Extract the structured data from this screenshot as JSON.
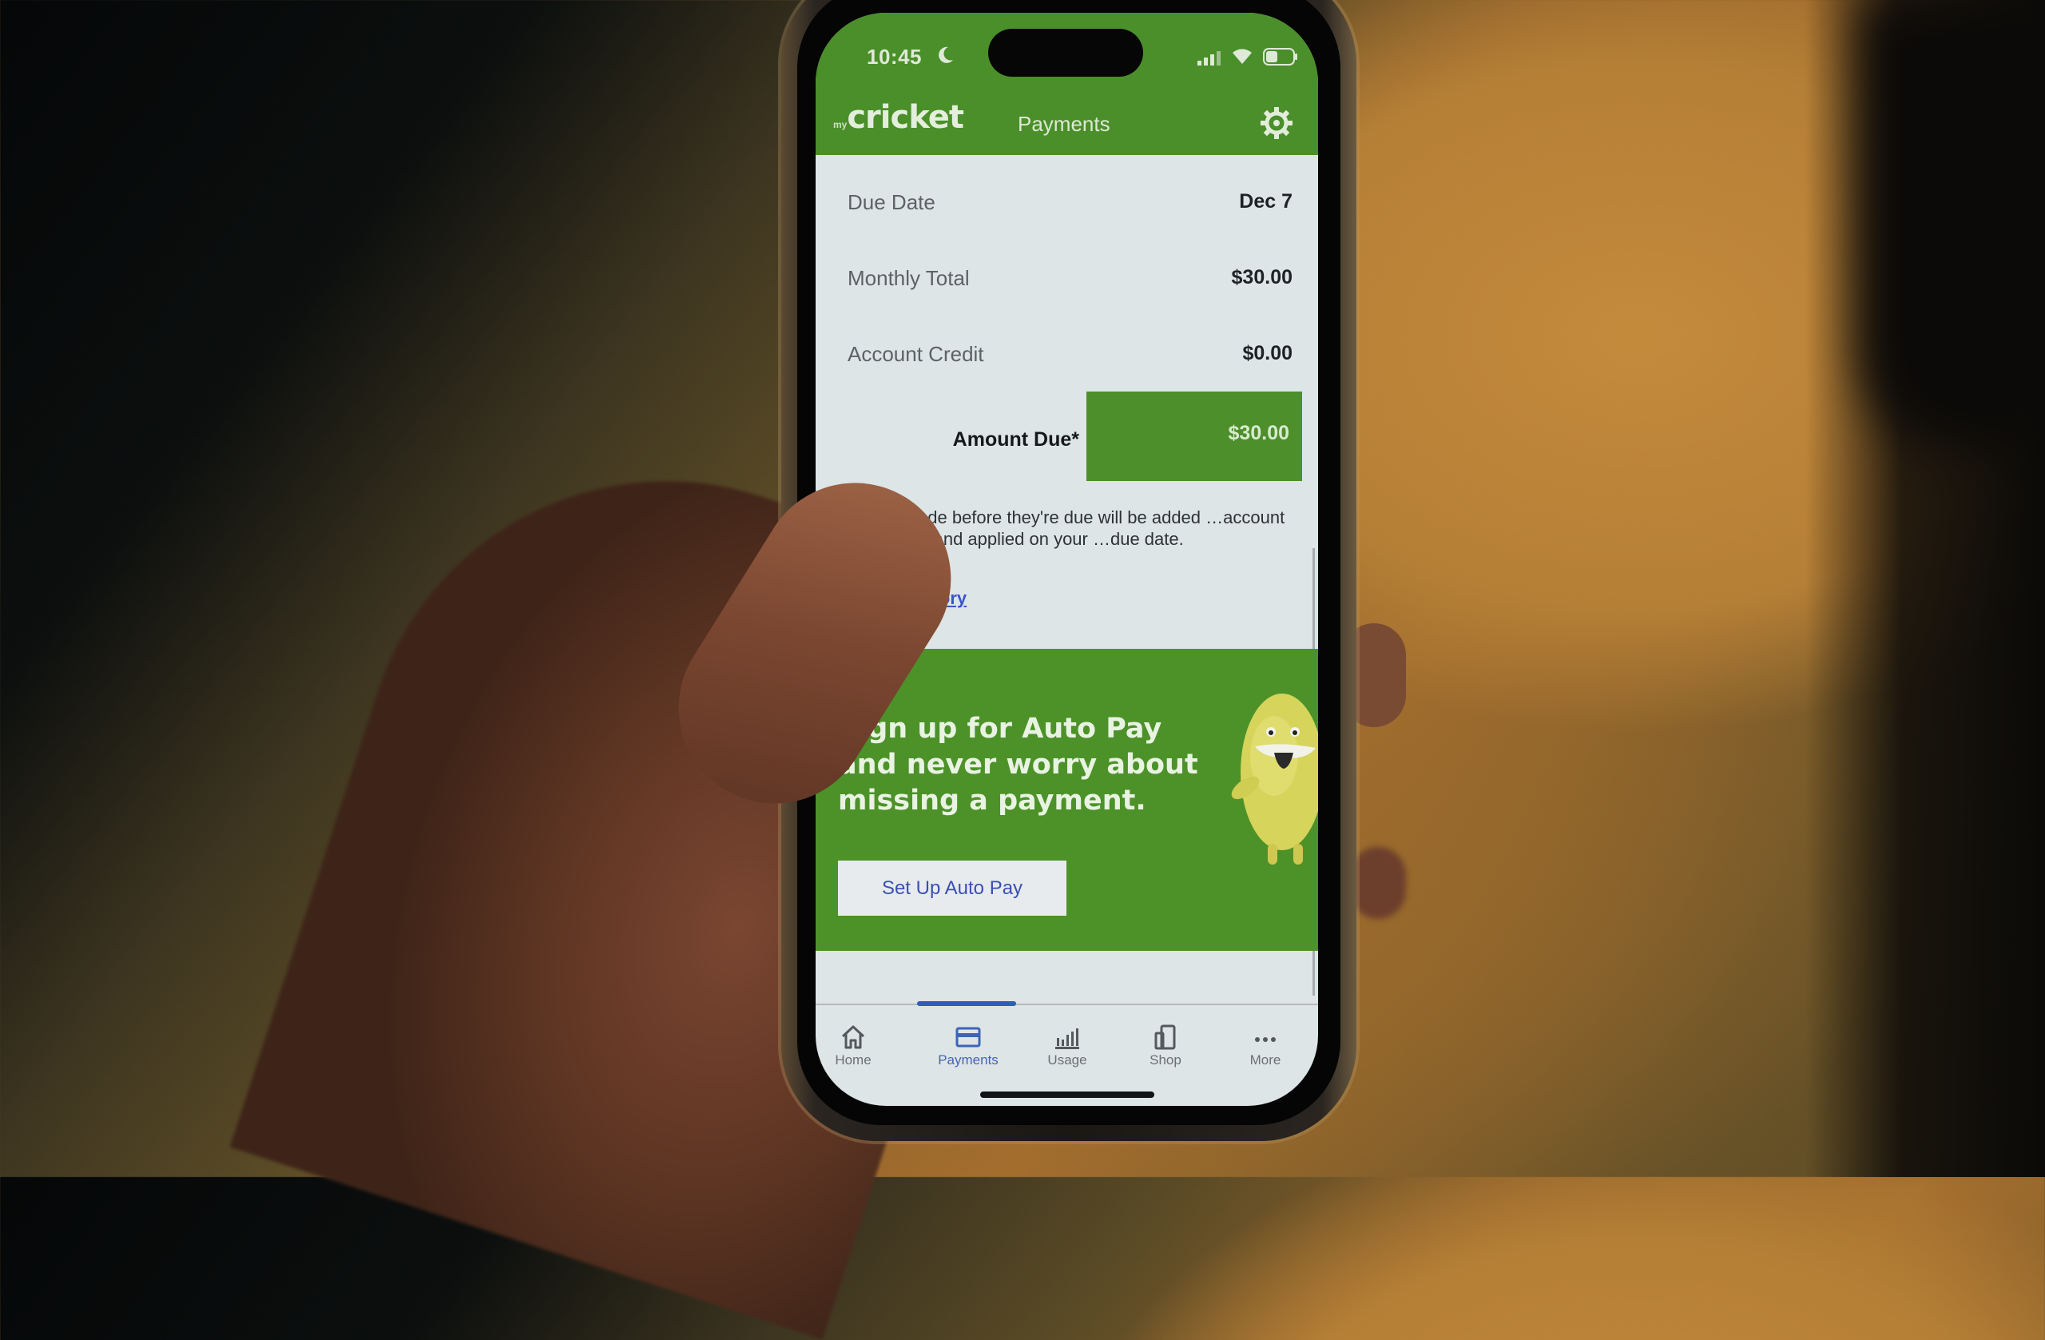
{
  "status_bar": {
    "time": "10:45",
    "focus_icon": "moon-icon",
    "signal_icon": "cellular-signal-icon",
    "wifi_icon": "wifi-icon",
    "battery_icon": "battery-icon"
  },
  "header": {
    "logo_prefix": "my",
    "logo_text": "cricket",
    "title": "Payments",
    "settings_icon": "gear-icon"
  },
  "summary": {
    "rows": [
      {
        "label": "Due Date",
        "value": "Dec 7"
      },
      {
        "label": "Monthly Total",
        "value": "$30.00"
      },
      {
        "label": "Account Credit",
        "value": "$0.00"
      }
    ],
    "amount_due_label": "Amount Due*",
    "amount_due_value": "$30.00",
    "footnote": "…ents made before they're due will be added …account as a credit and applied on your …due date.",
    "billing_history_link": "Billing History"
  },
  "promo": {
    "title": "Sign up for Auto Pay and never worry about missing a payment.",
    "button_label": "Set Up Auto Pay",
    "mascot": "cricket-mascot-character"
  },
  "bottom_nav": {
    "active": "Payments",
    "items": [
      {
        "label": "Home",
        "icon": "home-icon"
      },
      {
        "label": "Payments",
        "icon": "credit-card-icon"
      },
      {
        "label": "Usage",
        "icon": "bar-chart-icon"
      },
      {
        "label": "Shop",
        "icon": "devices-icon"
      },
      {
        "label": "More",
        "icon": "ellipsis-icon"
      }
    ]
  },
  "colors": {
    "brand_green": "#4a8f29",
    "link_blue": "#3a55c9",
    "nav_active_blue": "#2c5fb8"
  }
}
